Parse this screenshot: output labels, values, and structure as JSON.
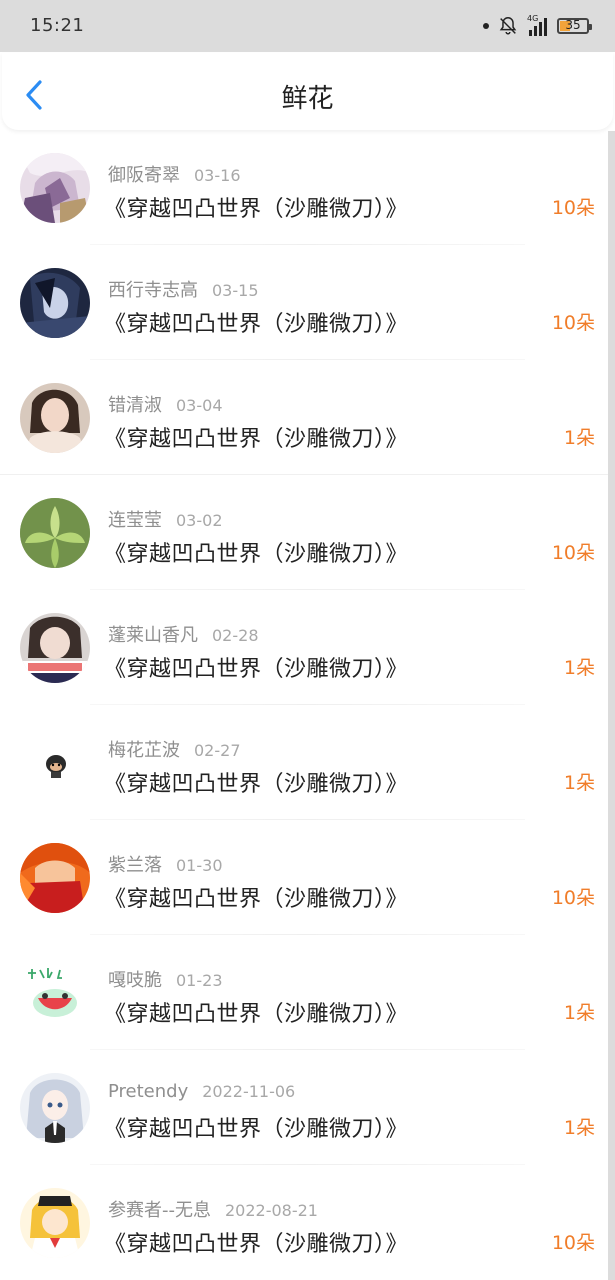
{
  "status_bar": {
    "time": "15:21",
    "network": "4G",
    "battery": "35"
  },
  "header": {
    "title": "鲜花"
  },
  "accent_color": "#f07d2a",
  "items": [
    {
      "name": "御阪寄翠",
      "date": "03-16",
      "book": "《穿越凹凸世界（沙雕微刀）》",
      "amount": "10朵"
    },
    {
      "name": "西行寺志高",
      "date": "03-15",
      "book": "《穿越凹凸世界（沙雕微刀）》",
      "amount": "10朵"
    },
    {
      "name": "错清淑",
      "date": "03-04",
      "book": "《穿越凹凸世界（沙雕微刀）》",
      "amount": "1朵"
    },
    {
      "name": "连莹莹",
      "date": "03-02",
      "book": "《穿越凹凸世界（沙雕微刀）》",
      "amount": "10朵"
    },
    {
      "name": "蓬莱山香凡",
      "date": "02-28",
      "book": "《穿越凹凸世界（沙雕微刀）》",
      "amount": "1朵"
    },
    {
      "name": "梅花芷波",
      "date": "02-27",
      "book": "《穿越凹凸世界（沙雕微刀）》",
      "amount": "1朵"
    },
    {
      "name": "紫兰落",
      "date": "01-30",
      "book": "《穿越凹凸世界（沙雕微刀）》",
      "amount": "10朵"
    },
    {
      "name": "嘎吱脆",
      "date": "01-23",
      "book": "《穿越凹凸世界（沙雕微刀）》",
      "amount": "1朵"
    },
    {
      "name": "Pretendy",
      "date": "2022-11-06",
      "book": "《穿越凹凸世界（沙雕微刀）》",
      "amount": "1朵"
    },
    {
      "name": "参赛者--无息",
      "date": "2022-08-21",
      "book": "《穿越凹凸世界（沙雕微刀）》",
      "amount": "10朵"
    }
  ]
}
